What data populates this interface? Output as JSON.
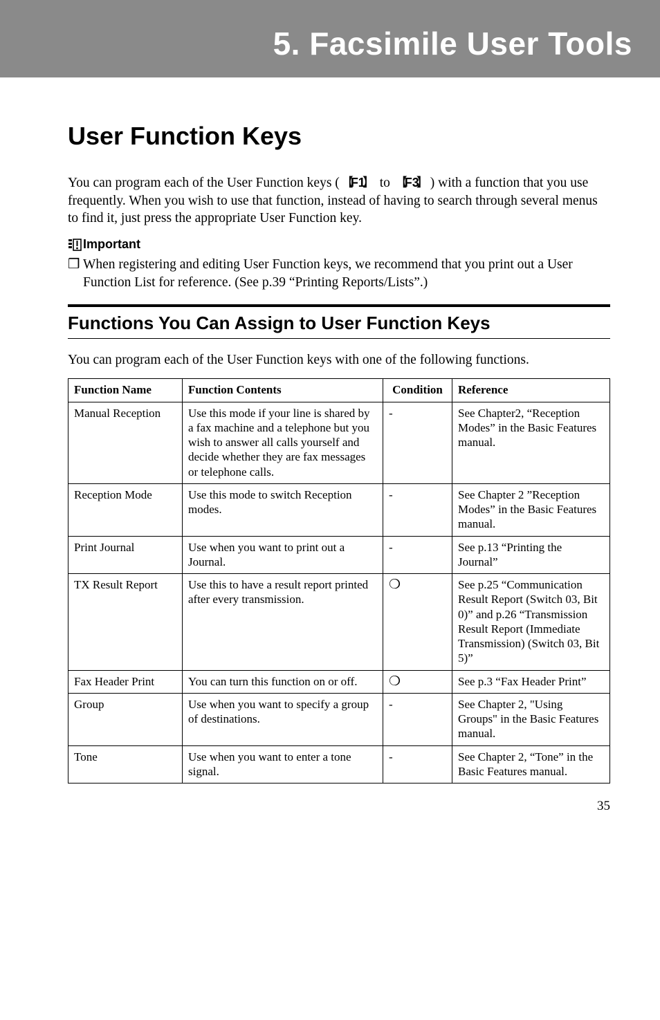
{
  "chapter": {
    "title": "5. Facsimile User Tools"
  },
  "h1": "User Function Keys",
  "intro_pre": "You can program each of the User Function keys (",
  "intro_key1": "F1",
  "intro_mid": " to ",
  "intro_key2": "F3",
  "intro_post": ") with a function that you use frequently. When you wish to use that function, instead of having to search through several menus to find it, just press the appropriate User Function key.",
  "important_label": "Important",
  "bullet_sym": "❒",
  "important_bullet": "When registering and editing User Function keys, we recommend that you print out a User Function List for reference. (See p.39 “Printing Reports/Lists”.)",
  "h2": "Functions You Can Assign to User Function Keys",
  "subintro": "You can program each of the User Function keys with one of the following functions.",
  "cols": {
    "name": "Function Name",
    "contents": "Function Contents",
    "condition": "Condition",
    "reference": "Reference"
  },
  "sym": {
    "dash": "-",
    "circle": "❍"
  },
  "rows": [
    {
      "name": "Manual Reception",
      "contents": "Use this mode if your line is shared by a fax machine and a telephone but you wish to answer all calls yourself and decide whether they are fax messages or telephone calls.",
      "condition": "-",
      "reference": "See Chapter2, “Reception Modes” in the Basic Features manual."
    },
    {
      "name": "Reception Mode",
      "contents": "Use this mode to switch Reception modes.",
      "condition": "-",
      "reference": "See Chapter 2 ”Reception Modes” in the Basic Features manual."
    },
    {
      "name": "Print Journal",
      "contents": "Use when you want to print out a Journal.",
      "condition": "-",
      "reference": "See p.13 “Printing the Journal”"
    },
    {
      "name": "TX Result Report",
      "contents": "Use this to have a result report printed after every transmission.",
      "condition": "❍",
      "reference": "See p.25 “Communication Result Report (Switch 03, Bit 0)” and p.26 “Transmission Result Report (Immediate Transmission) (Switch 03, Bit 5)”"
    },
    {
      "name": "Fax Header Print",
      "contents": "You can turn this function on or off.",
      "condition": "❍",
      "reference": "See p.3 “Fax Header Print”"
    },
    {
      "name": "Group",
      "contents": "Use when you want to specify a group of destinations.",
      "condition": "-",
      "reference": "See Chapter 2, \"Using Groups\" in the Basic Features manual."
    },
    {
      "name": "Tone",
      "contents": "Use when you want to enter a tone signal.",
      "condition": "-",
      "reference": "See Chapter 2, “Tone” in the Basic Features manual."
    }
  ],
  "page_number": "35"
}
